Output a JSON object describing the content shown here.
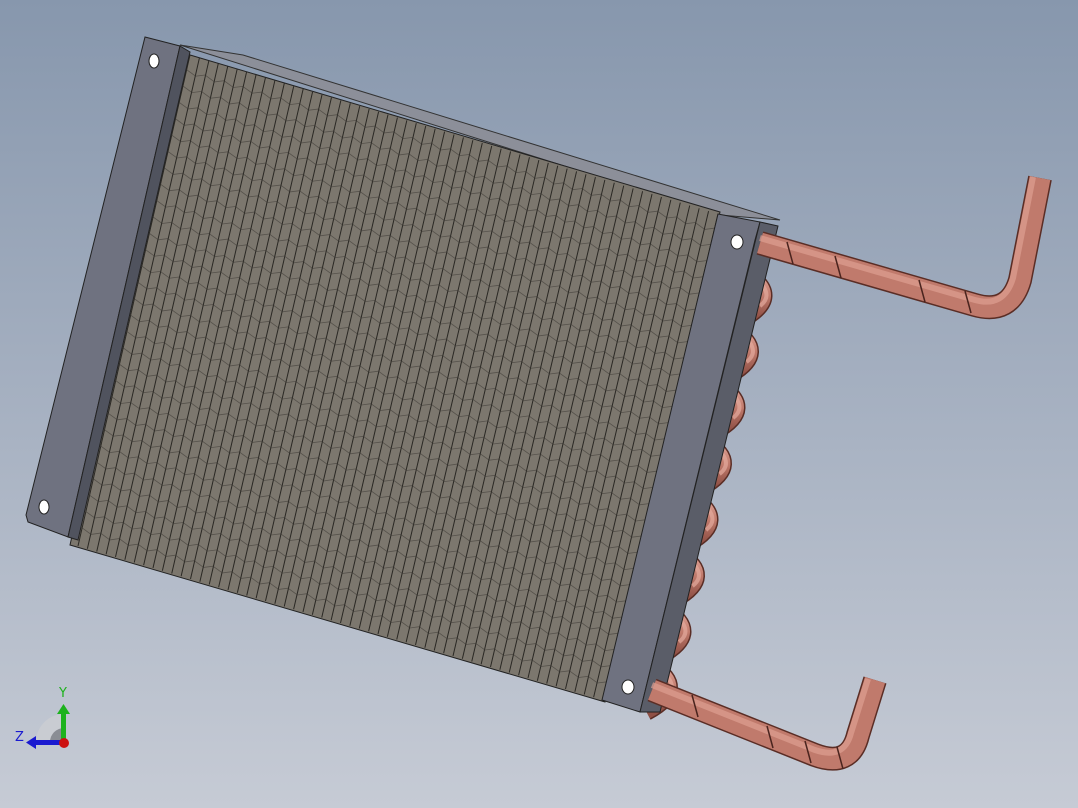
{
  "viewport": {
    "model": "heat-exchanger-coil"
  },
  "triad": {
    "y_label": "Y",
    "z_label": "Z",
    "y_color": "#1db21d",
    "z_color": "#1a1ad0",
    "x_color": "#cc1111"
  },
  "colors": {
    "fins": "#7c776e",
    "plates": "#6f7280",
    "copper": "#c07a6c"
  }
}
